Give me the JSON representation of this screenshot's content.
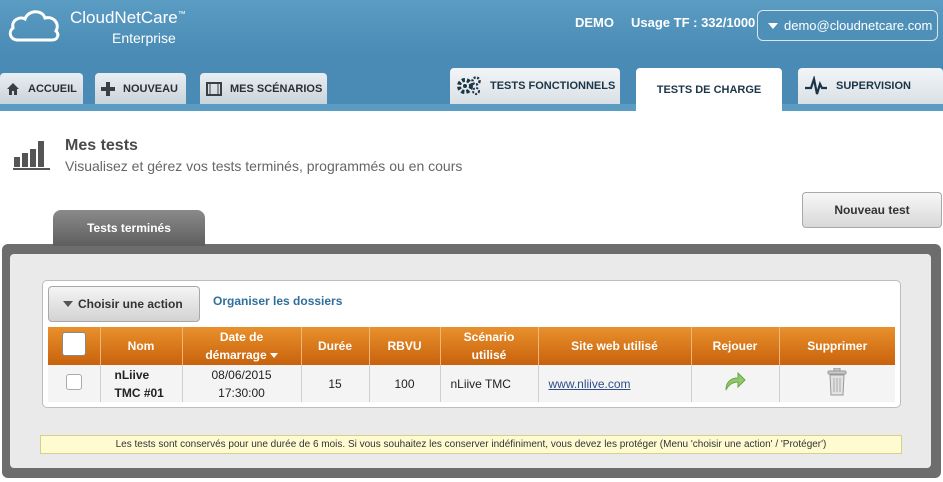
{
  "header": {
    "brand": "CloudNetCare",
    "brand_mark": "™",
    "brand_sub": "Enterprise",
    "account": "DEMO",
    "usage": "Usage TF : 332/1000",
    "user_email": "demo@cloudnetcare.com"
  },
  "nav": {
    "left_tabs": [
      {
        "label": "ACCUEIL",
        "icon": "home-icon"
      },
      {
        "label": "NOUVEAU",
        "icon": "plus-icon"
      },
      {
        "label": "MES SCÉNARIOS",
        "icon": "film-icon"
      }
    ],
    "right_tabs": [
      {
        "label": "TESTS FONCTIONNELS",
        "icon": "gears-icon"
      },
      {
        "label": "TESTS DE CHARGE",
        "active": true
      },
      {
        "label": "SUPERVISION",
        "icon": "pulse-icon"
      }
    ]
  },
  "page": {
    "title": "Mes tests",
    "subtitle": "Visualisez et gérez vos tests terminés, programmés ou en cours",
    "new_test_button": "Nouveau test",
    "section_tab": "Tests terminés",
    "action_button": "Choisir une action",
    "organize_link": "Organiser les dossiers"
  },
  "table": {
    "headers": [
      "",
      "Nom",
      "Date de démarrage",
      "Durée",
      "RBVU",
      "Scénario utilisé",
      "Site web utilisé",
      "Rejouer",
      "Supprimer"
    ],
    "header_lines": {
      "date": [
        "Date de",
        "démarrage"
      ],
      "scenario": [
        "Scénario",
        "utilisé"
      ]
    },
    "rows": [
      {
        "name_line1": "nLiive",
        "name_line2": "TMC #01",
        "date": "08/06/2015",
        "time": "17:30:00",
        "duration": "15",
        "rbvu": "100",
        "scenario": "nLiive TMC",
        "site": "www.nliive.com"
      }
    ]
  },
  "notice": "Les tests sont conservés pour une durée de 6 mois. Si vous souhaitez les conserver indéfiniment, vous devez les protéger (Menu 'choisir une action' / 'Protéger')",
  "colors": {
    "header_blue": "#4a8bb5",
    "table_header_orange": "#d9771b",
    "replay_green": "#8fc96a"
  }
}
